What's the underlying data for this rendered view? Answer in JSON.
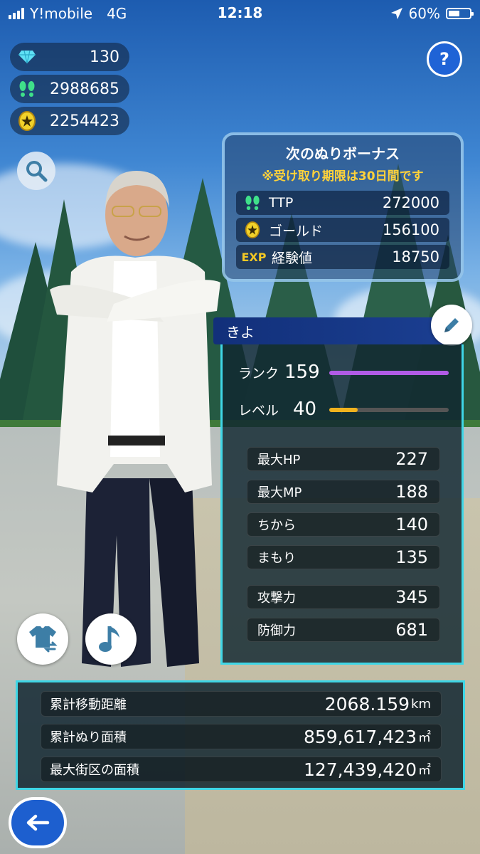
{
  "status_bar": {
    "carrier": "Y!mobile",
    "network": "4G",
    "time": "12:18",
    "battery": "60%",
    "battery_level": 0.6
  },
  "currencies": [
    {
      "icon": "diamond-icon",
      "value": "130"
    },
    {
      "icon": "footprints-icon",
      "value": "2988685"
    },
    {
      "icon": "gold-coin-icon",
      "value": "2254423"
    }
  ],
  "help_label": "?",
  "bonus": {
    "title": "次のぬりボーナス",
    "note": "※受け取り期限は30日間です",
    "rows": [
      {
        "icon": "footprints-icon",
        "label": "TTP",
        "value": "272000"
      },
      {
        "icon": "gold-coin-icon",
        "label": "ゴールド",
        "value": "156100"
      },
      {
        "icon": "exp-icon",
        "icon_text": "EXP",
        "label": "経験値",
        "value": "18750"
      }
    ]
  },
  "player": {
    "name": "きよ",
    "rank_label": "ランク",
    "rank": "159",
    "rank_progress": 1.0,
    "level_label": "レベル",
    "level": "40",
    "level_progress": 0.24
  },
  "stats": [
    {
      "label": "最大HP",
      "value": "227"
    },
    {
      "label": "最大MP",
      "value": "188"
    },
    {
      "label": "ちから",
      "value": "140"
    },
    {
      "label": "まもり",
      "value": "135"
    },
    {
      "label": "攻撃力",
      "value": "345"
    },
    {
      "label": "防御力",
      "value": "681"
    }
  ],
  "totals": [
    {
      "label": "累計移動距離",
      "value": "2068.159",
      "unit": "km"
    },
    {
      "label": "累計ぬり面積",
      "value": "859,617,423",
      "unit": "㎡"
    },
    {
      "label": "最大街区の面積",
      "value": "127,439,420",
      "unit": "㎡"
    }
  ],
  "colors": {
    "accent_cyan": "#3fd6e6",
    "rank_bar": "#b15be6",
    "level_bar": "#f0b21e",
    "name_bar": "#1b3f92",
    "note_yellow": "#ffd23a",
    "back_button": "#1d5fcf"
  }
}
